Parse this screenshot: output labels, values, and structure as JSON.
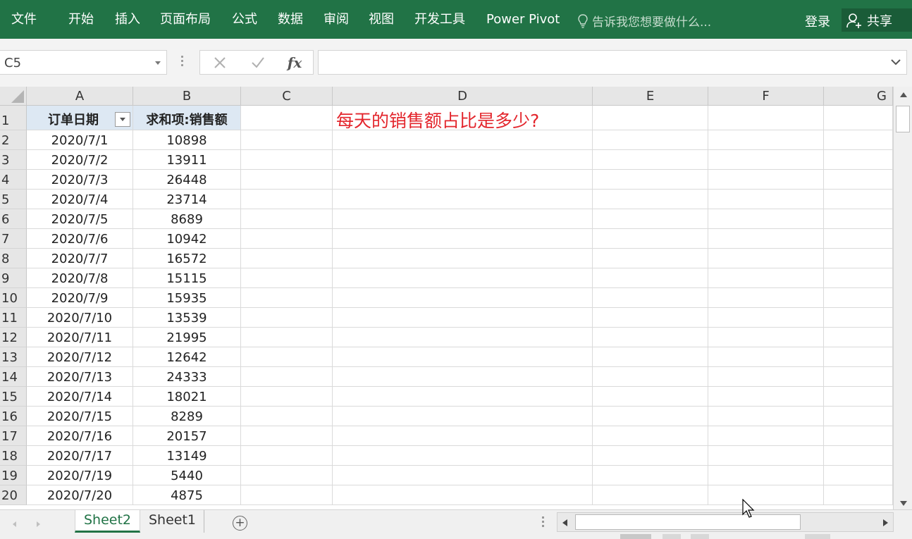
{
  "ribbon": {
    "tabs": [
      "文件",
      "开始",
      "插入",
      "页面布局",
      "公式",
      "数据",
      "审阅",
      "视图",
      "开发工具",
      "Power Pivot"
    ],
    "tellme_placeholder": "告诉我您想要做什么...",
    "login_label": "登录",
    "share_label": "共享",
    "colors": {
      "ribbon_bg": "#217346",
      "share_bg": "#1a5c38"
    }
  },
  "formula_bar": {
    "name_box": "C5",
    "formula": "",
    "fx_label": "fx"
  },
  "grid": {
    "columns": [
      "A",
      "B",
      "C",
      "D",
      "E",
      "F",
      "G"
    ],
    "header_row": {
      "row": "1",
      "a": "订单日期",
      "b": "求和项:销售额"
    },
    "rows": [
      {
        "row": "2",
        "date": "2020/7/1",
        "sales": "10898"
      },
      {
        "row": "3",
        "date": "2020/7/2",
        "sales": "13911"
      },
      {
        "row": "4",
        "date": "2020/7/3",
        "sales": "26448"
      },
      {
        "row": "5",
        "date": "2020/7/4",
        "sales": "23714"
      },
      {
        "row": "6",
        "date": "2020/7/5",
        "sales": "8689"
      },
      {
        "row": "7",
        "date": "2020/7/6",
        "sales": "10942"
      },
      {
        "row": "8",
        "date": "2020/7/7",
        "sales": "16572"
      },
      {
        "row": "9",
        "date": "2020/7/8",
        "sales": "15115"
      },
      {
        "row": "10",
        "date": "2020/7/9",
        "sales": "15935"
      },
      {
        "row": "11",
        "date": "2020/7/10",
        "sales": "13539"
      },
      {
        "row": "12",
        "date": "2020/7/11",
        "sales": "21995"
      },
      {
        "row": "13",
        "date": "2020/7/12",
        "sales": "12642"
      },
      {
        "row": "14",
        "date": "2020/7/13",
        "sales": "24333"
      },
      {
        "row": "15",
        "date": "2020/7/14",
        "sales": "18021"
      },
      {
        "row": "16",
        "date": "2020/7/15",
        "sales": "8289"
      },
      {
        "row": "17",
        "date": "2020/7/16",
        "sales": "20157"
      },
      {
        "row": "18",
        "date": "2020/7/17",
        "sales": "13149"
      },
      {
        "row": "19",
        "date": "2020/7/19",
        "sales": "5440"
      },
      {
        "row": "20",
        "date": "2020/7/20",
        "sales": "4875"
      }
    ],
    "note": "每天的销售额占比是多少?",
    "note_color": "#e3252c"
  },
  "sheets": {
    "tabs": [
      "Sheet2",
      "Sheet1"
    ],
    "active": "Sheet2"
  }
}
